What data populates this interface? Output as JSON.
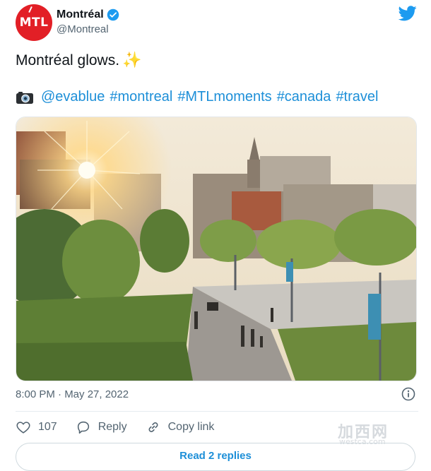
{
  "account": {
    "avatar_text": "MTL",
    "display_name": "Montréal",
    "handle": "@Montreal"
  },
  "tweet": {
    "text": "Montréal glows.",
    "emoji": "✨",
    "tags": [
      "@evablue",
      "#montreal",
      "#MTLmoments",
      "#canada",
      "#travel"
    ],
    "timestamp": "8:00 PM · May 27, 2022"
  },
  "actions": {
    "likes": "107",
    "reply_label": "Reply",
    "copy_label": "Copy link"
  },
  "read_replies_label": "Read 2 replies",
  "watermark": {
    "main": "加西网",
    "sub": "westca.com"
  },
  "colors": {
    "accent": "#1d8fd8",
    "brand_red": "#e21f26",
    "verified": "#1d9bf0"
  }
}
